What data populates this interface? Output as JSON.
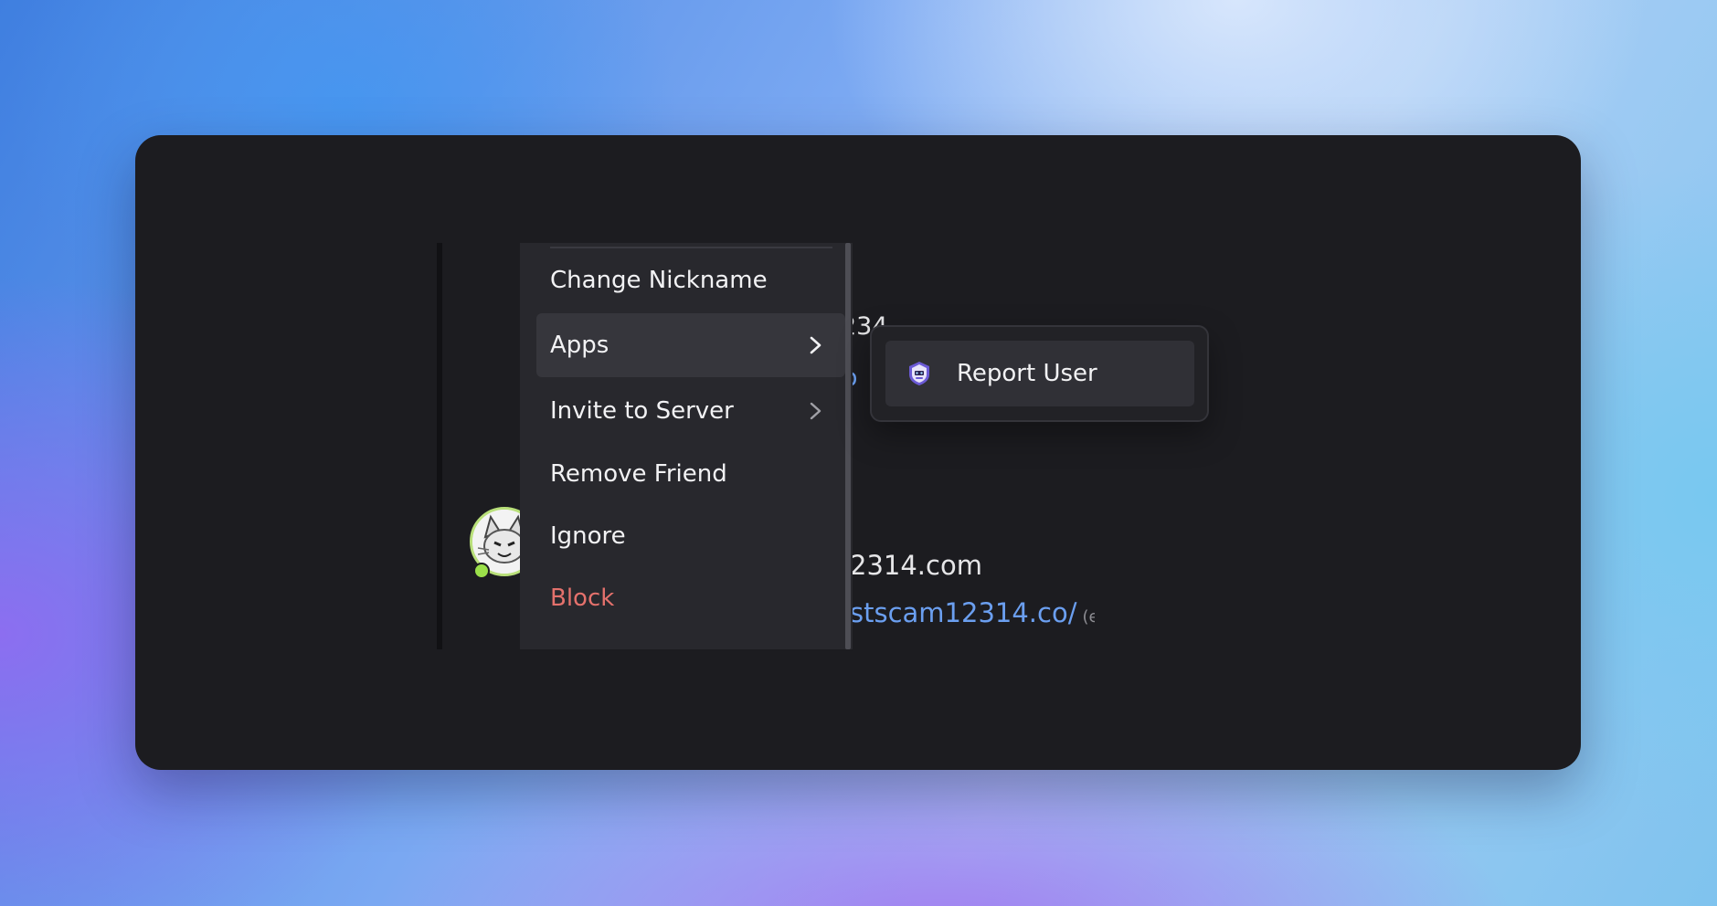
{
  "chat": {
    "partial_username": "234",
    "partial_link_top": "o",
    "message_title_partial": "2314.com",
    "message_link_partial": "stscam12314.co/",
    "edited_label": "(edited)"
  },
  "context_menu": {
    "items": [
      {
        "label": "Change Nickname",
        "has_submenu": false,
        "active": false
      },
      {
        "label": "Apps",
        "has_submenu": true,
        "active": true
      },
      {
        "label": "Invite to Server",
        "has_submenu": true,
        "active": false
      },
      {
        "label": "Remove Friend",
        "has_submenu": false,
        "active": false
      },
      {
        "label": "Ignore",
        "has_submenu": false,
        "active": false
      },
      {
        "label": "Block",
        "has_submenu": false,
        "active": false,
        "danger": true
      }
    ]
  },
  "apps_submenu": {
    "items": [
      {
        "label": "Report User",
        "icon": "bot-app-icon"
      }
    ]
  },
  "colors": {
    "window_bg": "#1c1c20",
    "menu_bg": "#28282d",
    "link": "#6b9ff0",
    "danger": "#e4716c"
  }
}
